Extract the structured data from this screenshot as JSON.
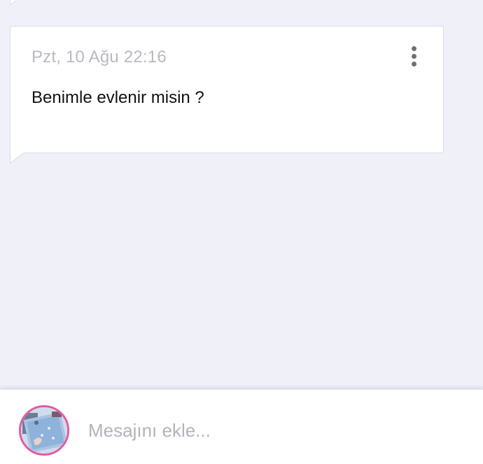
{
  "message": {
    "timestamp": "Pzt, 10 Ağu 22:16",
    "text": "Benimle evlenir misin ?",
    "menu_icon": "more-vertical-icon"
  },
  "composer": {
    "placeholder": "Mesajını ekle...",
    "value": "",
    "avatar_ring_color": "#e25aa0"
  },
  "colors": {
    "background": "#f0f0f9",
    "bubble": "#ffffff",
    "timestamp": "#b9b9c2",
    "text": "#111111"
  }
}
